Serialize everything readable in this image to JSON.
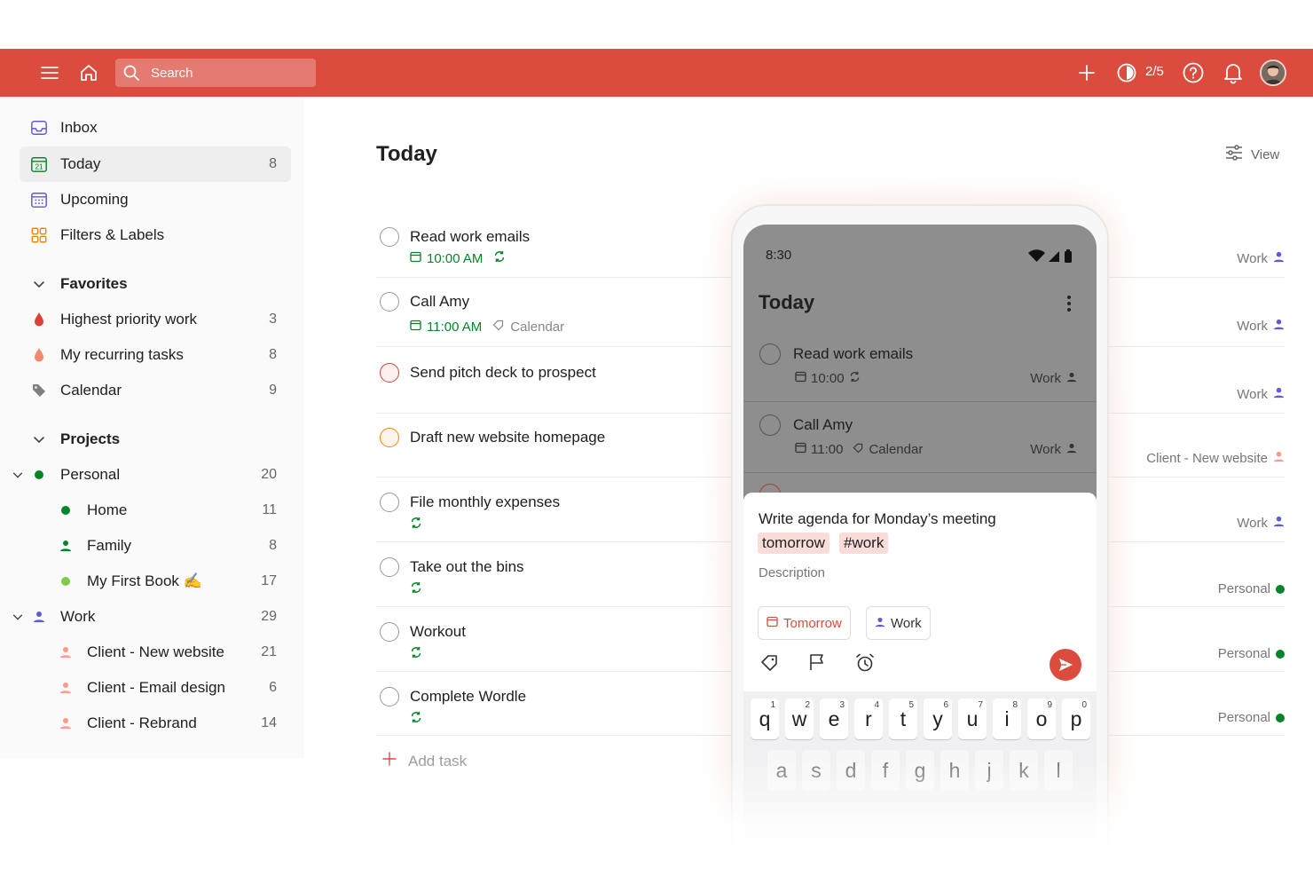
{
  "topbar": {
    "search_placeholder": "Search",
    "karma": "2/5",
    "accent": "#dc4c3e"
  },
  "sidebar": {
    "nav": [
      {
        "label": "Inbox",
        "icon": "inbox-icon"
      },
      {
        "label": "Today",
        "icon": "calendar-today-icon",
        "day": "21",
        "count": "8",
        "active": true
      },
      {
        "label": "Upcoming",
        "icon": "calendar-grid-icon"
      },
      {
        "label": "Filters & Labels",
        "icon": "grid-icon"
      }
    ],
    "favorites_header": "Favorites",
    "favorites": [
      {
        "label": "Highest priority work",
        "count": "3",
        "icon": "drop-icon"
      },
      {
        "label": "My recurring tasks",
        "count": "8",
        "icon": "drop-icon"
      },
      {
        "label": "Calendar",
        "count": "9",
        "icon": "tag-icon"
      }
    ],
    "projects_header": "Projects",
    "projects": [
      {
        "label": "Personal",
        "count": "20"
      },
      {
        "label": "Home",
        "count": "11"
      },
      {
        "label": "Family",
        "count": "8"
      },
      {
        "label": "My First Book ✍️",
        "count": "17"
      },
      {
        "label": "Work",
        "count": "29"
      },
      {
        "label": "Client - New website",
        "count": "21"
      },
      {
        "label": "Client - Email design",
        "count": "6"
      },
      {
        "label": "Client - Rebrand",
        "count": "14"
      }
    ]
  },
  "main": {
    "title": "Today",
    "view_label": "View",
    "tasks": [
      {
        "title": "Read work emails",
        "time": "10:00 AM",
        "project": "Work"
      },
      {
        "title": "Call Amy",
        "time": "11:00 AM",
        "label": "Calendar",
        "project": "Work"
      },
      {
        "title": "Send pitch deck to prospect",
        "project": "Work"
      },
      {
        "title": "Draft new website homepage",
        "project": "Client - New website"
      },
      {
        "title": "File monthly expenses",
        "project": "Work"
      },
      {
        "title": "Take out the bins",
        "project": "Personal"
      },
      {
        "title": "Workout",
        "project": "Personal"
      },
      {
        "title": "Complete Wordle",
        "project": "Personal"
      }
    ],
    "add_task": "Add task"
  },
  "phone": {
    "time": "8:30",
    "title": "Today",
    "tasks": [
      {
        "title": "Read work emails",
        "time": "10:00",
        "project": "Work"
      },
      {
        "title": "Call Amy",
        "time": "11:00",
        "label": "Calendar",
        "project": "Work"
      }
    ],
    "composer": {
      "text": "Write agenda for Monday’s meeting",
      "chip_date": "tomorrow",
      "chip_tag": "#work",
      "description_placeholder": "Description",
      "date_pill": "Tomorrow",
      "project_pill": "Work"
    },
    "keyboard": {
      "row1": [
        "q",
        "w",
        "e",
        "r",
        "t",
        "y",
        "u",
        "i",
        "o",
        "p"
      ],
      "row1_nums": [
        "1",
        "2",
        "3",
        "4",
        "5",
        "6",
        "7",
        "8",
        "9",
        "0"
      ],
      "row2": [
        "a",
        "s",
        "d",
        "f",
        "g",
        "h",
        "j",
        "k",
        "l"
      ]
    }
  }
}
